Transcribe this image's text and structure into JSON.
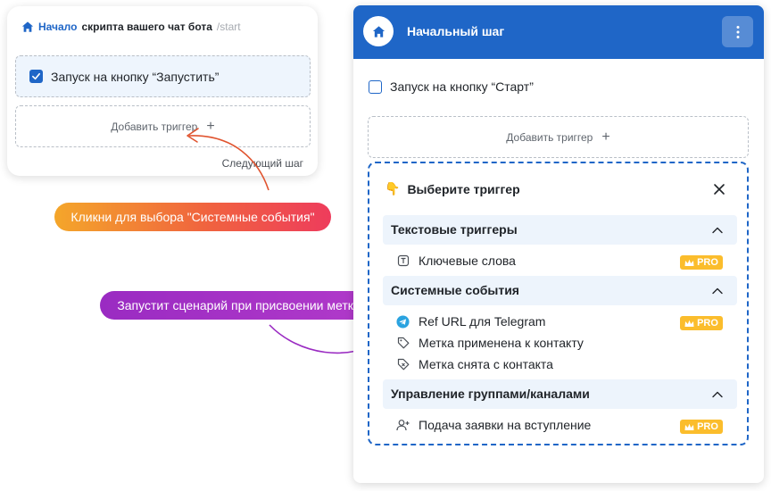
{
  "left_card": {
    "start_label": "Начало",
    "title": "скрипта вашего чат бота",
    "command": "/start",
    "trigger_label": "Запуск на кнопку “Запустить”",
    "add_trigger_label": "Добавить триггер",
    "next_step_label": "Следующий шаг"
  },
  "callouts": {
    "orange": "Кликни для выбора \"Системные события\"",
    "purple": "Запустит сценарий при присвоении метки"
  },
  "panel": {
    "title": "Начальный шаг",
    "trigger_label": "Запуск на кнопку “Старт”",
    "add_trigger_label": "Добавить триггер",
    "selector": {
      "heading_emoji": "👇",
      "heading": "Выберите триггер",
      "pro_label": "PRO",
      "sections": [
        {
          "label": "Текстовые триггеры",
          "items": [
            {
              "label": "Ключевые слова",
              "icon": "keyword-icon",
              "pro": true
            }
          ]
        },
        {
          "label": "Системные события",
          "items": [
            {
              "label": "Ref URL для Telegram",
              "icon": "telegram-icon",
              "pro": true
            },
            {
              "label": "Метка применена к контакту",
              "icon": "tag-icon",
              "pro": false
            },
            {
              "label": "Метка снята с контакта",
              "icon": "tag-remove-icon",
              "pro": false
            }
          ]
        },
        {
          "label": "Управление группами/каналами",
          "items": [
            {
              "label": "Подача заявки на вступление",
              "icon": "user-add-icon",
              "pro": true
            }
          ]
        }
      ]
    }
  },
  "colors": {
    "brand_blue": "#1f66c7",
    "pro_gold": "#fbbd2c",
    "orange_start": "#f4a62a",
    "orange_end": "#ee3c5c",
    "purple": "#9a2bc2"
  }
}
